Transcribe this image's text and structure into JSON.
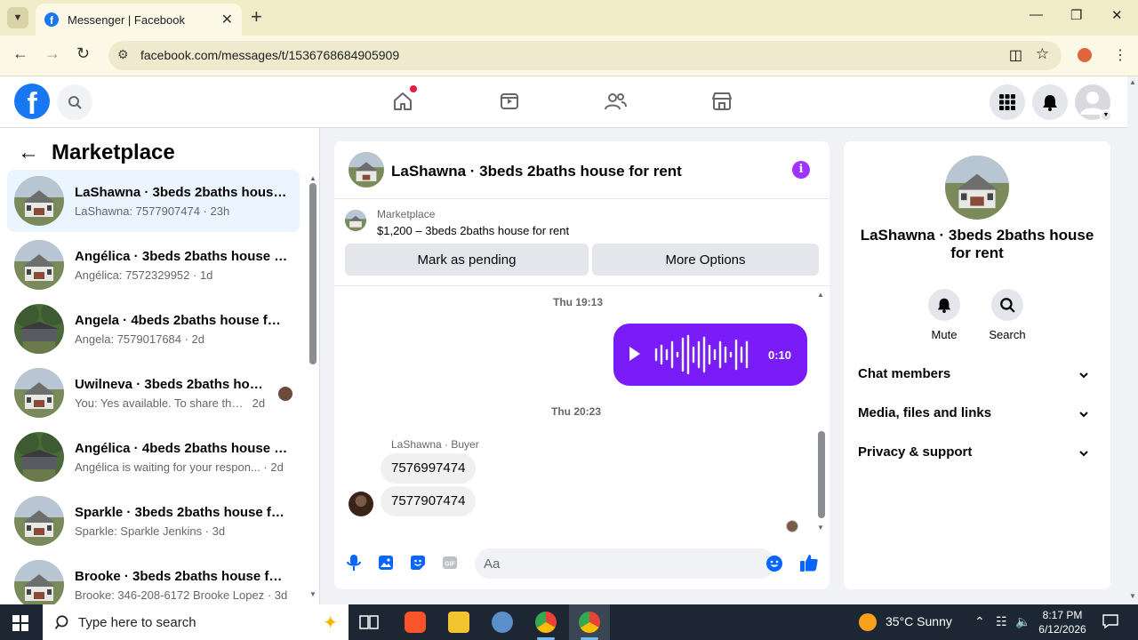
{
  "browser": {
    "tab_title": "Messenger | Facebook",
    "url": "facebook.com/messages/t/1536768684905909"
  },
  "sidebar": {
    "title": "Marketplace",
    "conversations": [
      {
        "name": "LaShawna · 3beds 2baths house for rent",
        "preview": "LaShawna: 7577907474 · 23h",
        "active": true
      },
      {
        "name": "Angélica · 3beds 2baths house for rent",
        "preview": "Angélica: 7572329952 · 1d"
      },
      {
        "name": "Angela · 4beds 2baths house for rent",
        "preview": "Angela: 7579017684 · 2d"
      },
      {
        "name": "Uwilneva · 3beds 2baths house for rent",
        "preview": "You: Yes available. To share the a...",
        "time": "2d"
      },
      {
        "name": "Angélica · 4beds 2baths house for rent",
        "preview": "Angélica is waiting for your respon... · 2d"
      },
      {
        "name": "Sparkle · 3beds 2baths house for rent",
        "preview": "Sparkle: Sparkle Jenkins · 3d"
      },
      {
        "name": "Brooke · 3beds 2baths house for rent",
        "preview": "Brooke: 346-208-6172 Brooke Lopez · 3d"
      }
    ]
  },
  "chat": {
    "title": "LaShawna · 3beds 2baths house for rent",
    "marketplace_label": "Marketplace",
    "listing": "$1,200 – 3beds 2baths house for rent",
    "mark_pending": "Mark as pending",
    "more_options": "More Options",
    "time1": "Thu 19:13",
    "voice_duration": "0:10",
    "time2": "Thu 20:23",
    "sender": "LaShawna · Buyer",
    "messages": [
      "7576997474",
      "7577907474"
    ],
    "input_placeholder": "Aa"
  },
  "info_panel": {
    "name": "LaShawna · 3beds 2baths house for rent",
    "mute": "Mute",
    "search": "Search",
    "rows": [
      "Chat members",
      "Media, files and links",
      "Privacy & support"
    ]
  },
  "taskbar": {
    "search_placeholder": "Type here to search",
    "weather": "35°C  Sunny",
    "time": "8:17 PM",
    "date": "6/12/2026"
  },
  "colors": {
    "accent": "#7a1cf7",
    "facebook_blue": "#1877f2",
    "active_row": "#ebf5ff"
  }
}
